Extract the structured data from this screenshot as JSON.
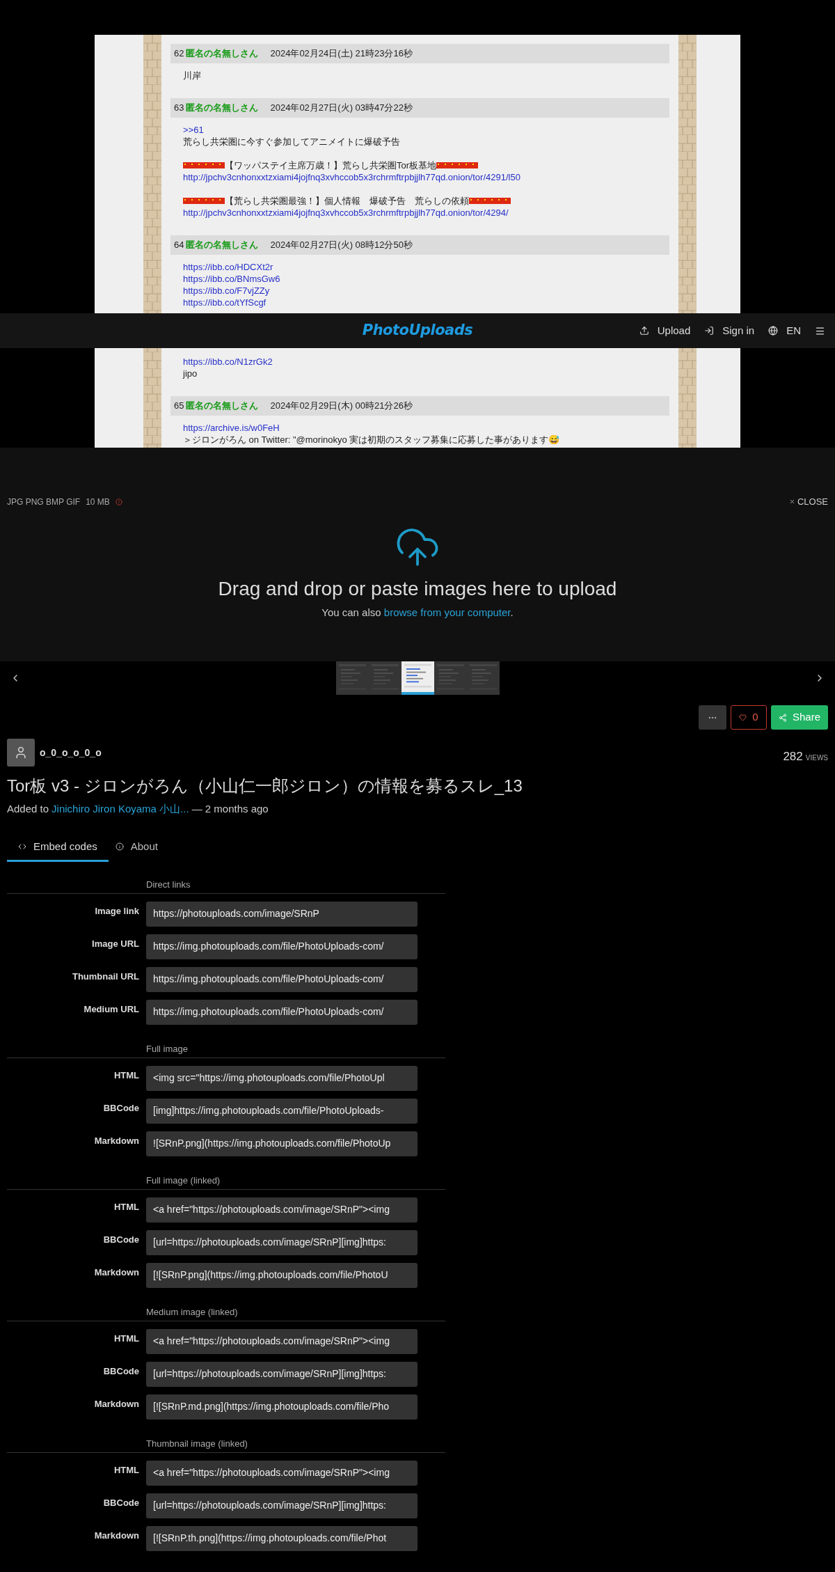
{
  "screenshot": {
    "posts": [
      {
        "number": "62",
        "name": "匿名の名無しさん",
        "date": "2024年02月24日(土) 21時23分16秒",
        "lines": [
          {
            "kind": "text",
            "text": "川岸"
          }
        ]
      },
      {
        "number": "63",
        "name": "匿名の名無しさん",
        "date": "2024年02月27日(火) 03時47分22秒",
        "lines": [
          {
            "kind": "link",
            "text": ">>61"
          },
          {
            "kind": "text",
            "text": "荒らし共栄圏に今すぐ参加してアニメイトに爆破予告"
          },
          {
            "kind": "gap"
          },
          {
            "kind": "flagged",
            "text": "【ワッパステイ主席万歳！】荒らし共栄圏Tor板基地"
          },
          {
            "kind": "link",
            "text": "http://jpchv3cnhonxxtzxiami4jojfnq3xvhccob5x3rchrmftrpbjjlh77qd.onion/tor/4291/l50"
          },
          {
            "kind": "gap"
          },
          {
            "kind": "flagged",
            "text": "【荒らし共栄圏最強！】個人情報　爆破予告　荒らしの依頼"
          },
          {
            "kind": "link",
            "text": "http://jpchv3cnhonxxtzxiami4jojfnq3xvhccob5x3rchrmftrpbjjlh77qd.onion/tor/4294/"
          }
        ]
      },
      {
        "number": "64",
        "name": "匿名の名無しさん",
        "date": "2024年02月27日(火) 08時12分50秒",
        "lines": [
          {
            "kind": "link",
            "text": "https://ibb.co/HDCXt2r"
          },
          {
            "kind": "link",
            "text": "https://ibb.co/BNmsGw6"
          },
          {
            "kind": "link",
            "text": "https://ibb.co/F7vjZZy"
          },
          {
            "kind": "link",
            "text": "https://ibb.co/tYfScgf"
          },
          {
            "kind": "gap"
          },
          {
            "kind": "gap"
          },
          {
            "kind": "gap"
          },
          {
            "kind": "gap"
          },
          {
            "kind": "link",
            "text": "https://ibb.co/N1zrGk2"
          },
          {
            "kind": "text",
            "text": "jipo"
          }
        ]
      },
      {
        "number": "65",
        "name": "匿名の名無しさん",
        "date": "2024年02月29日(木) 00時21分26秒",
        "lines": [
          {
            "kind": "link",
            "text": "https://archive.is/w0FeH"
          },
          {
            "kind": "text",
            "text": "＞ジロンがろん on Twitter: \"@morinokyo 実は初期のスタッフ募集に応募した事があります😅"
          }
        ]
      }
    ]
  },
  "header": {
    "logo": "PhotoUploads",
    "items": [
      {
        "kind": "upload",
        "label": "Upload"
      },
      {
        "kind": "signin",
        "label": "Sign in"
      },
      {
        "kind": "language",
        "label": "EN"
      },
      {
        "kind": "menu"
      }
    ]
  },
  "uploader": {
    "formats": "JPG PNG BMP GIF",
    "size": "10 MB",
    "close": "CLOSE",
    "heading": "Drag and drop or paste images here to upload",
    "sub_before": "You can also",
    "sub_link": "browse from your computer",
    "sub_after": "."
  },
  "thumbnails": [
    {
      "kind": "picture",
      "selected": false
    },
    {
      "kind": "picture",
      "selected": false
    },
    {
      "kind": "picture",
      "selected": true
    },
    {
      "kind": "picture",
      "selected": false
    },
    {
      "kind": "picture",
      "selected": false
    }
  ],
  "actions": {
    "likes": "0",
    "share": "Share"
  },
  "user": {
    "name": "o_0_o_o_0_o"
  },
  "views": {
    "count": "282",
    "label": "VIEWS"
  },
  "title": "Tor板 v3 - ジロンがろん（小山仁一郎ジロン）の情報を募るスレ_13",
  "added": {
    "prefix": "Added to",
    "album": "Jinichiro Jiron Koyama 小山...",
    "suffix": "— 2 months ago"
  },
  "tabs": [
    {
      "kind": "embed",
      "label": "Embed codes",
      "selected": true
    },
    {
      "kind": "about",
      "label": "About",
      "selected": false
    }
  ],
  "sections": [
    {
      "heading": "Direct links",
      "rows": [
        {
          "label": "Image link",
          "value": "https://photouploads.com/image/SRnP"
        },
        {
          "label": "Image URL",
          "value": "https://img.photouploads.com/file/PhotoUploads-com/"
        },
        {
          "label": "Thumbnail URL",
          "value": "https://img.photouploads.com/file/PhotoUploads-com/"
        },
        {
          "label": "Medium URL",
          "value": "https://img.photouploads.com/file/PhotoUploads-com/"
        }
      ]
    },
    {
      "heading": "Full image",
      "rows": [
        {
          "label": "HTML",
          "value": "<img src=\"https://img.photouploads.com/file/PhotoUpl"
        },
        {
          "label": "BBCode",
          "value": "[img]https://img.photouploads.com/file/PhotoUploads-"
        },
        {
          "label": "Markdown",
          "value": "![SRnP.png](https://img.photouploads.com/file/PhotoUp"
        }
      ]
    },
    {
      "heading": "Full image (linked)",
      "rows": [
        {
          "label": "HTML",
          "value": "<a href=\"https://photouploads.com/image/SRnP\"><img"
        },
        {
          "label": "BBCode",
          "value": "[url=https://photouploads.com/image/SRnP][img]https:"
        },
        {
          "label": "Markdown",
          "value": "[![SRnP.png](https://img.photouploads.com/file/PhotoU"
        }
      ]
    },
    {
      "heading": "Medium image (linked)",
      "rows": [
        {
          "label": "HTML",
          "value": "<a href=\"https://photouploads.com/image/SRnP\"><img"
        },
        {
          "label": "BBCode",
          "value": "[url=https://photouploads.com/image/SRnP][img]https:"
        },
        {
          "label": "Markdown",
          "value": "[![SRnP.md.png](https://img.photouploads.com/file/Pho"
        }
      ]
    },
    {
      "heading": "Thumbnail image (linked)",
      "rows": [
        {
          "label": "HTML",
          "value": "<a href=\"https://photouploads.com/image/SRnP\"><img"
        },
        {
          "label": "BBCode",
          "value": "[url=https://photouploads.com/image/SRnP][img]https:"
        },
        {
          "label": "Markdown",
          "value": "[![SRnP.th.png](https://img.photouploads.com/file/Phot"
        }
      ]
    }
  ]
}
